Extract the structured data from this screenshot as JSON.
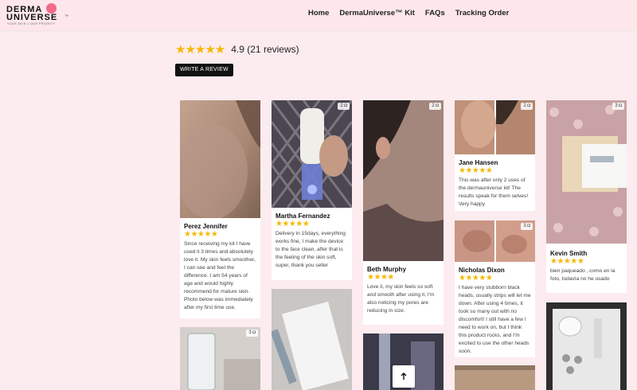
{
  "brand": {
    "line1": "DERMA",
    "line2": "UNIVERSE",
    "tagline": "YOUR SKIN 1 OUR PRIORITY",
    "tm": "™"
  },
  "nav": [
    "Home",
    "DermaUniverse™ Kit",
    "FAQs",
    "Tracking Order"
  ],
  "summary": {
    "stars": "★★★★★",
    "score": "4.9 (21 reviews)"
  },
  "write_review": "WRITE A REVIEW",
  "reviews": [
    {
      "name": "Perez Jennifer",
      "stars": "★★★★★",
      "text": "Since receiving my kit I have used it 3 times and absolutely love it. My skin feels smoother, I can see and feel the difference. I am 54 years of age and would highly recommend for mature skin. Photo below was immediately after my first time use."
    },
    {
      "name": "Martha Fernandez",
      "stars": "★★★★★",
      "photo_count": "2",
      "text": "Delivery in 15days, everything works fine, I make the device to the face clean, after that is the feeling of the skin soft, super, thank you seller"
    },
    {
      "name": "Beth Murphy",
      "stars": "★★★★",
      "photo_count": "2",
      "text": "Love it, my skin feels so soft and smooth after using it, I'm also noticing my pores are reducing in size."
    },
    {
      "name": "Jane Hansen",
      "stars": "★★★★★",
      "photo_count": "2",
      "text": "This was after only 2 uses of the dermauniverse kit! The results speak for them selves! Very happy"
    },
    {
      "name": "Nicholas Dixon",
      "stars": "★★★★★",
      "photo_count": "3",
      "text": "I have very stubborn black heads, usually strips will let me down. After using 4 times, it took so many out with no discomfort! I still have a few I need to work on, but I think this product rocks, and I'm excited to use the other heads soon."
    },
    {
      "name": "Kevin Smith",
      "stars": "★★★★★",
      "photo_count": "3",
      "text": "bien paqueado , como en la foto, todavía no he usado"
    }
  ],
  "extra_photo_counts": [
    "3"
  ],
  "colors": {
    "accent": "#f06a8a",
    "star": "#f5b800",
    "background": "#fcecef"
  },
  "icons": {
    "camera": "camera-icon",
    "scroll_top": "arrow-up-icon"
  }
}
